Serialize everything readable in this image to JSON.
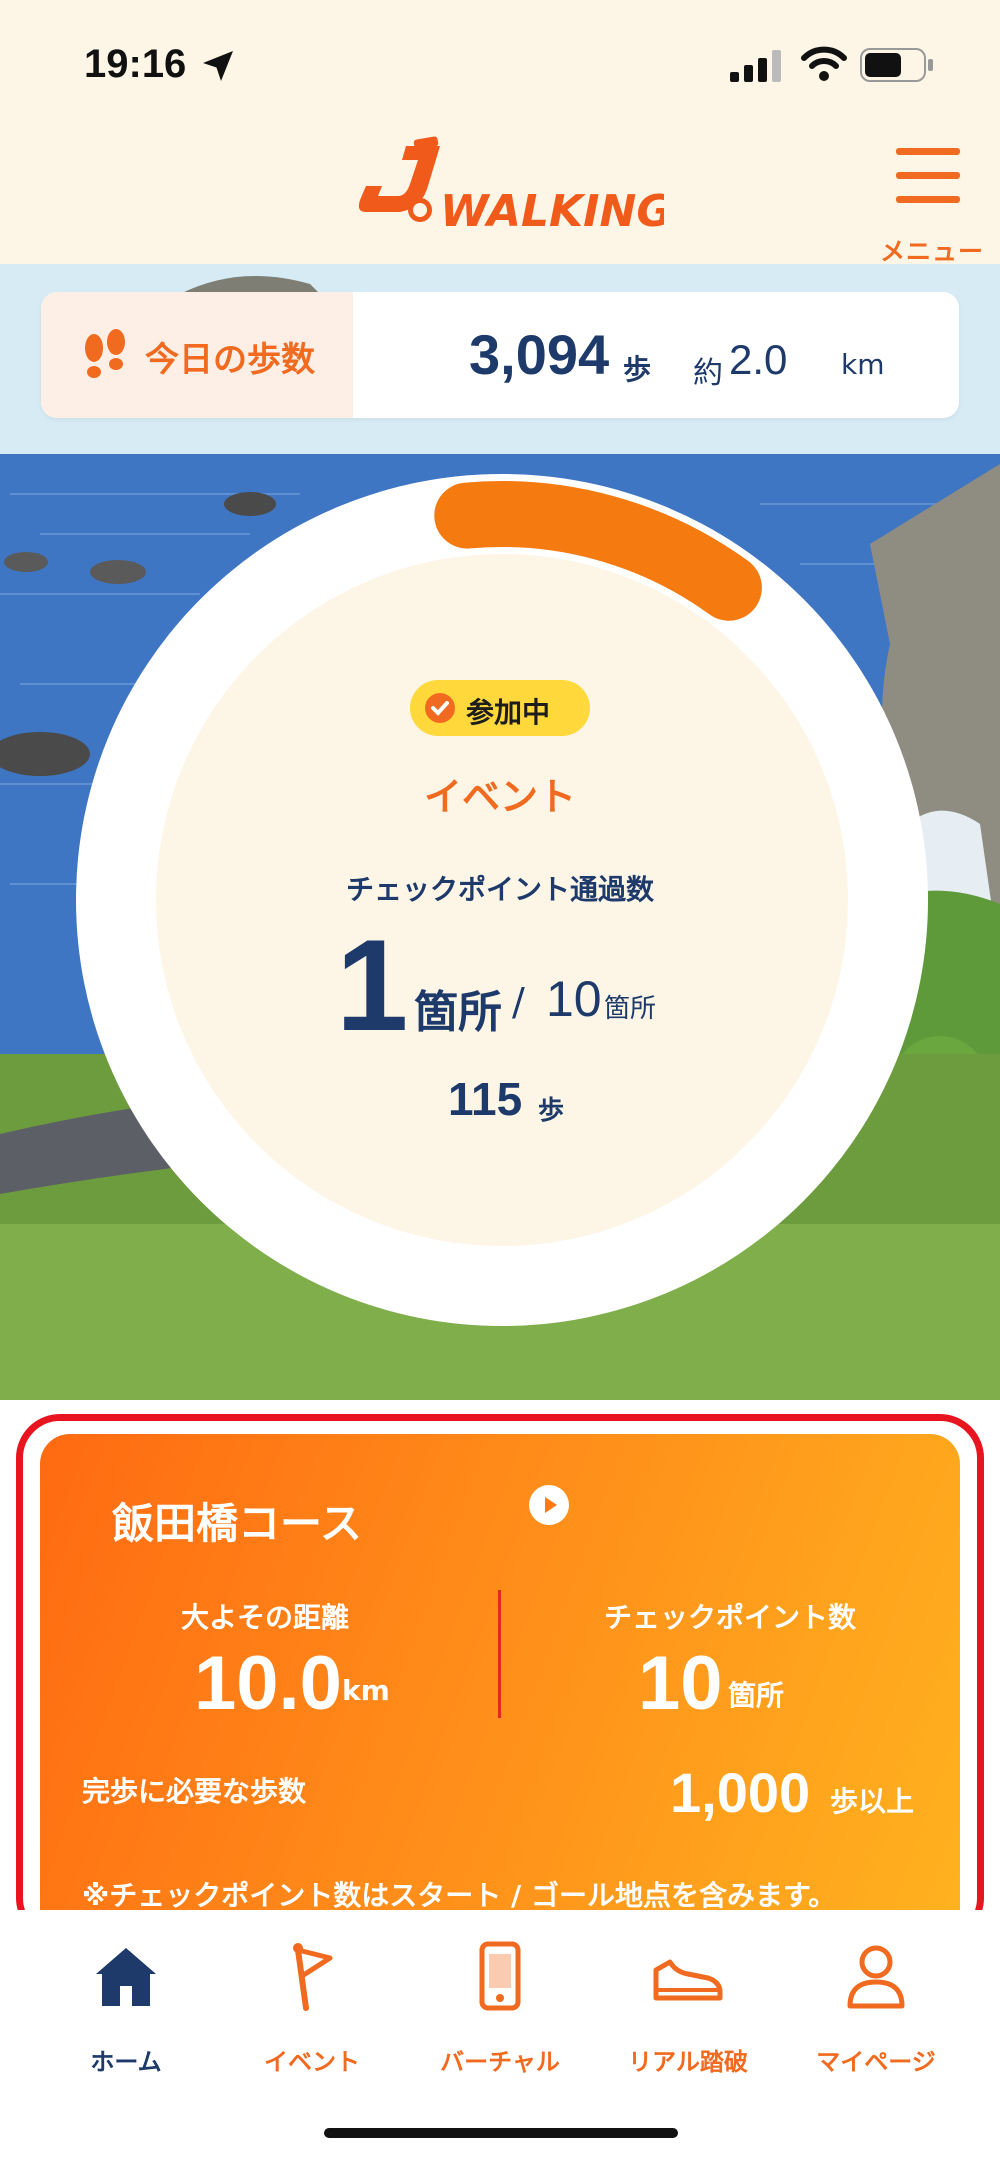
{
  "status_bar": {
    "time": "19:16"
  },
  "header": {
    "logo_text": "WALKING",
    "menu_label": "メニュー"
  },
  "today_steps": {
    "label": "今日の歩数",
    "steps": "3,094",
    "steps_unit": "歩",
    "distance_prefix": "約",
    "distance": "2.0",
    "distance_unit": "km"
  },
  "event_ring": {
    "badge": "参加中",
    "title": "イベント",
    "checkpoint_label": "チェックポイント通過数",
    "checkpoints_passed": "1",
    "checkpoints_unit": "箇所",
    "separator": "/",
    "checkpoints_total": "10",
    "checkpoints_total_unit": "箇所",
    "steps": "115",
    "steps_unit": "歩",
    "progress": 0.1
  },
  "course": {
    "title": "飯田橋コース",
    "distance_label": "大よその距離",
    "distance": "10.0",
    "distance_unit": "km",
    "checkpoint_label": "チェックポイント数",
    "checkpoints": "10",
    "checkpoints_unit": "箇所",
    "required_label": "完歩に必要な歩数",
    "required_steps": "1,000",
    "required_unit": "歩以上",
    "note": "※チェックポイント数はスタート / ゴール地点を含みます。"
  },
  "nav": [
    {
      "label": "ホーム",
      "icon": "home-icon",
      "active": true
    },
    {
      "label": "イベント",
      "icon": "flag-icon",
      "active": false
    },
    {
      "label": "バーチャル",
      "icon": "phone-icon",
      "active": false
    },
    {
      "label": "リアル踏破",
      "icon": "shoe-icon",
      "active": false
    },
    {
      "label": "マイページ",
      "icon": "person-icon",
      "active": false
    }
  ],
  "colors": {
    "accent": "#f06a1f",
    "navy": "#1d3a6b",
    "badge": "#ffd93b",
    "highlight": "#e8141f"
  }
}
